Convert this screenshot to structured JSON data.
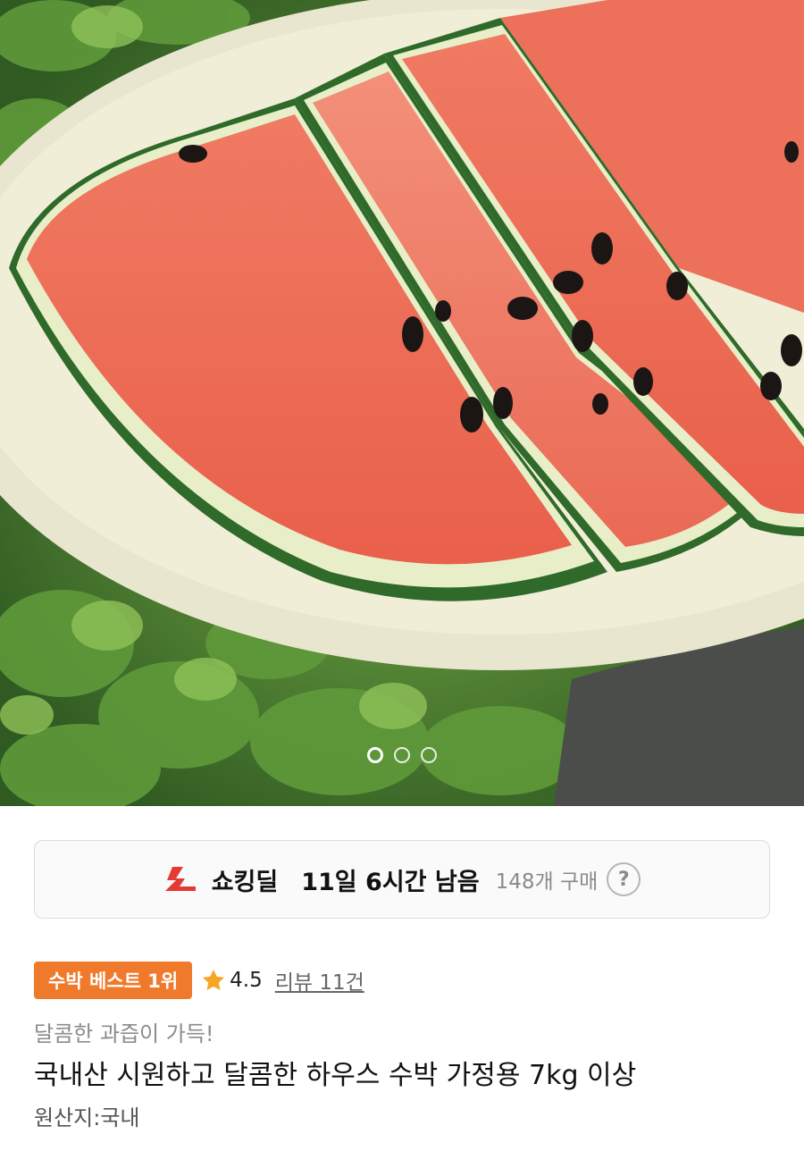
{
  "hero": {
    "image_subject": "watermelon slices on a plate over green leaves",
    "pagination": {
      "total": 3,
      "active": 1
    }
  },
  "deal": {
    "name": "쇼킹딜",
    "time_left": "11일 6시간 남음",
    "purchase_count": "148개 구매",
    "help_symbol": "?"
  },
  "product": {
    "badge": "수박 베스트 1위",
    "rating": "4.5",
    "review_link": "리뷰 11건",
    "subtitle": "달콤한 과즙이 가득!",
    "title": "국내산 시원하고 달콤한 하우스 수박 가정용 7kg 이상",
    "origin": "원산지:국내"
  },
  "colors": {
    "badge_bg": "#f07a2c",
    "deal_icon": "#e53935",
    "star": "#f6a623"
  },
  "icons": {
    "deal": "lightning-icon",
    "rating": "star-icon",
    "help": "question-circle-icon"
  }
}
